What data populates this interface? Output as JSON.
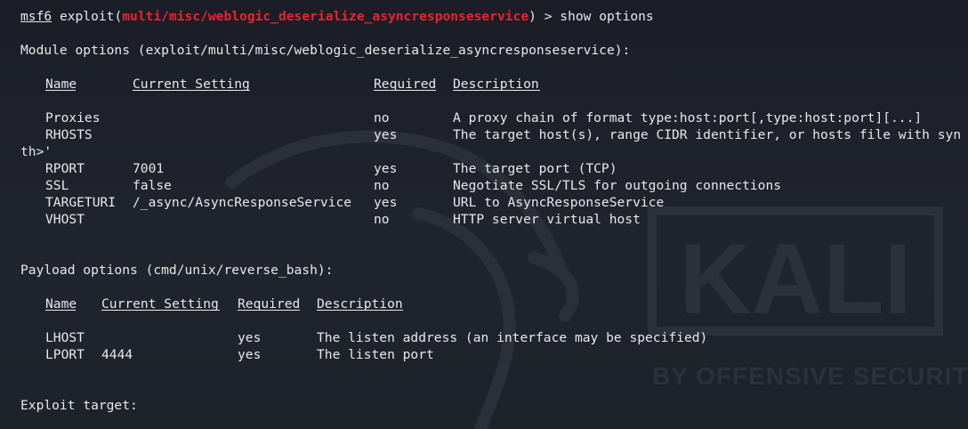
{
  "prompt": {
    "app": "msf6",
    "command_prefix": "exploit(",
    "module": "multi/misc/weblogic_deserialize_asyncresponseservice",
    "command_suffix": ") > show options"
  },
  "module_options": {
    "heading": "Module options (exploit/multi/misc/weblogic_deserialize_asyncresponseservice):",
    "columns": [
      "Name",
      "Current Setting",
      "Required",
      "Description"
    ],
    "rows": [
      {
        "name": "Proxies",
        "setting": "",
        "required": "no",
        "description": "A proxy chain of format type:host:port[,type:host:port][...]"
      },
      {
        "name": "RHOSTS",
        "setting": "",
        "required": "yes",
        "description": "The target host(s), range CIDR identifier, or hosts file with syn"
      },
      {
        "name": "",
        "setting": "",
        "required": "",
        "description": ""
      },
      {
        "name": "RPORT",
        "setting": "7001",
        "required": "yes",
        "description": "The target port (TCP)"
      },
      {
        "name": "SSL",
        "setting": "false",
        "required": "no",
        "description": "Negotiate SSL/TLS for outgoing connections"
      },
      {
        "name": "TARGETURI",
        "setting": "/_async/AsyncResponseService",
        "required": "yes",
        "description": "URL to AsyncResponseService"
      },
      {
        "name": "VHOST",
        "setting": "",
        "required": "no",
        "description": "HTTP server virtual host"
      }
    ],
    "wrap_fragment": "th>'"
  },
  "payload_options": {
    "heading": "Payload options (cmd/unix/reverse_bash):",
    "columns": [
      "Name",
      "Current Setting",
      "Required",
      "Description"
    ],
    "rows": [
      {
        "name": "LHOST",
        "setting": "",
        "required": "yes",
        "description": "The listen address (an interface may be specified)"
      },
      {
        "name": "LPORT",
        "setting": "4444",
        "required": "yes",
        "description": "The listen port"
      }
    ]
  },
  "exploit_target": {
    "heading": "Exploit target:"
  },
  "watermark": {
    "logo_text": "KALI",
    "tagline": "BY OFFENSIVE SECURITY",
    "logo_icon": "kali-dragon-icon"
  },
  "colors": {
    "background": "#1e2129",
    "text": "#e8e8e8",
    "module_highlight": "#e8252f",
    "watermark": "#2b2f38"
  }
}
